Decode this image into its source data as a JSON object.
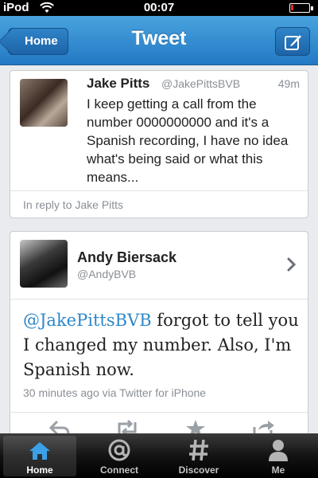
{
  "status_bar": {
    "carrier": "iPod",
    "time": "00:07"
  },
  "nav": {
    "back_label": "Home",
    "title": "Tweet"
  },
  "reply_tweet": {
    "name": "Jake Pitts",
    "handle": "@JakePittsBVB",
    "time": "49m",
    "text": "I keep getting a call from the number 0000000000 and it's a Spanish recording, I have no idea what's being said or what this means...",
    "reply_context": "In reply to Jake Pitts"
  },
  "main_tweet": {
    "name": "Andy Biersack",
    "handle": "@AndyBVB",
    "mention": "@JakePittsBVB",
    "text": " forgot to tell you I changed my number. Also, I'm Spanish now.",
    "meta": "30 minutes ago via Twitter for iPhone"
  },
  "tabs": [
    {
      "label": "Home",
      "icon": "home-icon",
      "active": true
    },
    {
      "label": "Connect",
      "icon": "at-sign-icon",
      "active": false
    },
    {
      "label": "Discover",
      "icon": "hashtag-icon",
      "active": false
    },
    {
      "label": "Me",
      "icon": "person-icon",
      "active": false
    }
  ],
  "colors": {
    "accent": "#2e87c8",
    "nav_blue": "#2379c4",
    "battery_low": "#e52a2a"
  }
}
